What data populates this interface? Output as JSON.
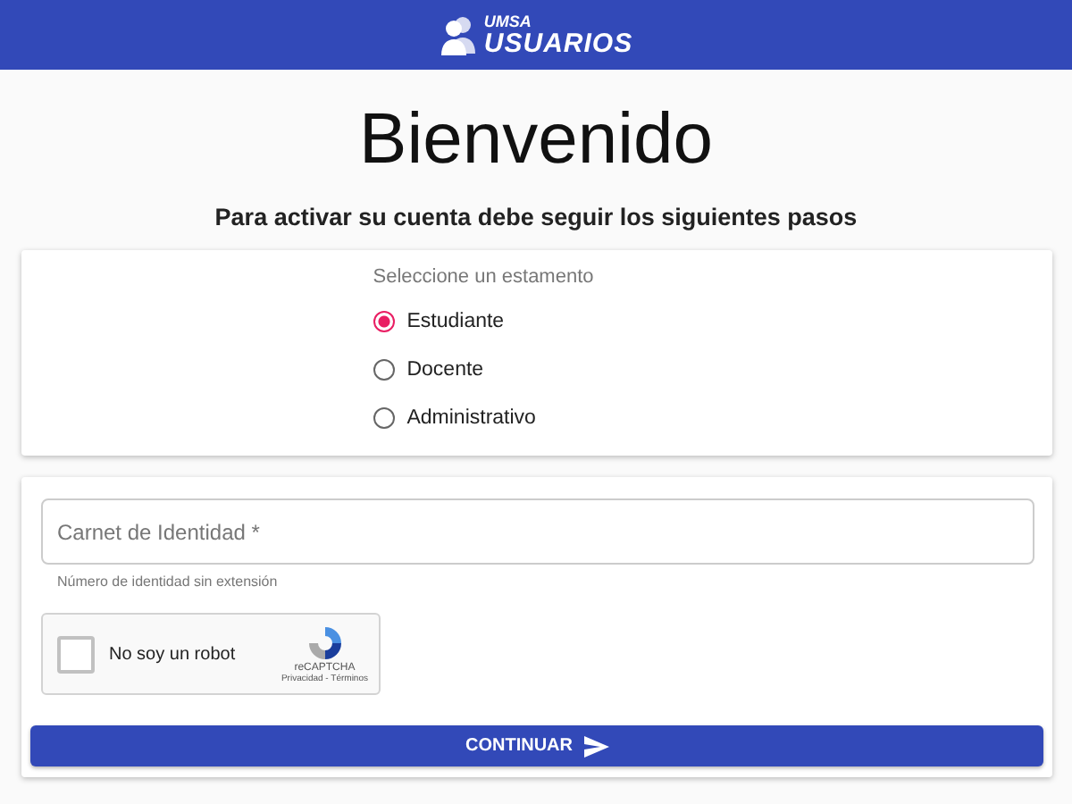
{
  "header": {
    "logo_top": "UMSA",
    "logo_bottom": "USUARIOS"
  },
  "title": "Bienvenido",
  "subtitle": "Para activar su cuenta debe seguir los siguientes pasos",
  "estamento": {
    "label": "Seleccione un estamento",
    "options": [
      {
        "label": "Estudiante",
        "selected": true
      },
      {
        "label": "Docente",
        "selected": false
      },
      {
        "label": "Administrativo",
        "selected": false
      }
    ]
  },
  "form": {
    "id_field": {
      "placeholder": "Carnet de Identidad *",
      "hint": "Número de identidad sin extensión"
    },
    "captcha": {
      "label": "No soy un robot",
      "checked": false,
      "brand": "reCAPTCHA",
      "links": "Privacidad - Términos"
    },
    "button": "CONTINUAR"
  }
}
